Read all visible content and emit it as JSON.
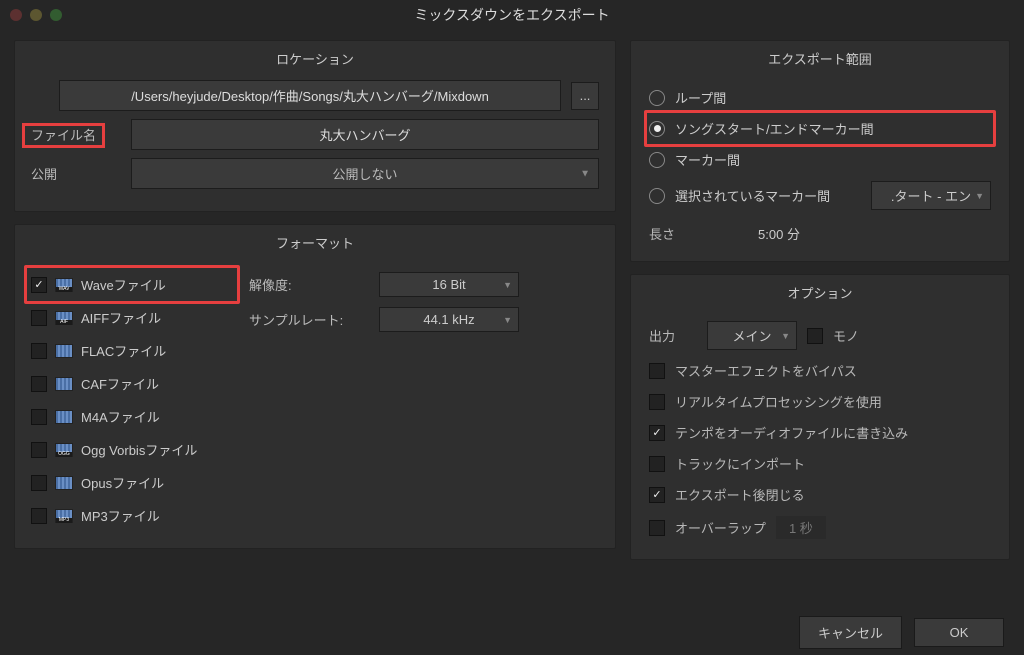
{
  "window": {
    "title": "ミックスダウンをエクスポート"
  },
  "location": {
    "title": "ロケーション",
    "path": "/Users/heyjude/Desktop/作曲/Songs/丸大ハンバーグ/Mixdown",
    "browse": "...",
    "filename_label": "ファイル名",
    "filename_value": "丸大ハンバーグ",
    "publish_label": "公開",
    "publish_value": "公開しない"
  },
  "format": {
    "title": "フォーマット",
    "items": [
      {
        "label": "Waveファイル",
        "checked": true,
        "tag": "WAV"
      },
      {
        "label": "AIFFファイル",
        "checked": false,
        "tag": "AIF"
      },
      {
        "label": "FLACファイル",
        "checked": false,
        "tag": ""
      },
      {
        "label": "CAFファイル",
        "checked": false,
        "tag": ""
      },
      {
        "label": "M4Aファイル",
        "checked": false,
        "tag": ""
      },
      {
        "label": "Ogg Vorbisファイル",
        "checked": false,
        "tag": "OGG"
      },
      {
        "label": "Opusファイル",
        "checked": false,
        "tag": ""
      },
      {
        "label": "MP3ファイル",
        "checked": false,
        "tag": "MP3"
      }
    ],
    "resolution_label": "解像度:",
    "resolution_value": "16 Bit",
    "samplerate_label": "サンプルレート:",
    "samplerate_value": "44.1 kHz"
  },
  "range": {
    "title": "エクスポート範囲",
    "opt_loop": "ループ間",
    "opt_songmarker": "ソングスタート/エンドマーカー間",
    "opt_marker": "マーカー間",
    "opt_selected_marker": "選択されているマーカー間",
    "marker_dd": ".タート - エン",
    "length_label": "長さ",
    "length_value": "5:00 分"
  },
  "options": {
    "title": "オプション",
    "output_label": "出力",
    "output_value": "メイン",
    "mono_label": "モノ",
    "bypass_master": "マスターエフェクトをバイパス",
    "realtime": "リアルタイムプロセッシングを使用",
    "tempo": "テンポをオーディオファイルに書き込み",
    "import_track": "トラックにインポート",
    "close_after": "エクスポート後閉じる",
    "overlap_label": "オーバーラップ",
    "overlap_value": "1 秒"
  },
  "footer": {
    "cancel": "キャンセル",
    "ok": "OK"
  }
}
